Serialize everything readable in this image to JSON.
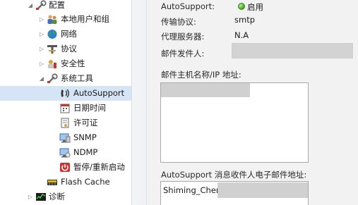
{
  "tree": {
    "items": [
      {
        "label": "配置",
        "icon": "wrench-icon",
        "expanded": true
      },
      {
        "label": "本地用户和组",
        "icon": "users-icon",
        "expanded": false
      },
      {
        "label": "网络",
        "icon": "globe-icon",
        "expanded": false
      },
      {
        "label": "协议",
        "icon": "protocol-icon",
        "expanded": false
      },
      {
        "label": "安全性",
        "icon": "security-icon",
        "expanded": false
      },
      {
        "label": "系统工具",
        "icon": "wrench-icon",
        "expanded": true
      },
      {
        "label": "AutoSupport",
        "icon": "autosupport-icon",
        "selected": true
      },
      {
        "label": "日期时间",
        "icon": "calendar-icon"
      },
      {
        "label": "许可证",
        "icon": "license-icon"
      },
      {
        "label": "SNMP",
        "icon": "snmp-icon"
      },
      {
        "label": "NDMP",
        "icon": "ndmp-icon"
      },
      {
        "label": "暂停/重新启动",
        "icon": "power-icon"
      },
      {
        "label": "Flash Cache",
        "icon": "flash-cache-icon"
      },
      {
        "label": "诊断",
        "icon": "diagnostics-icon",
        "expanded": false
      }
    ]
  },
  "form": {
    "autosupport_label": "AutoSupport:",
    "autosupport_value": "启用",
    "transport_label": "传输协议:",
    "transport_value": "smtp",
    "proxy_label": "代理服务器:",
    "proxy_value": "N.A",
    "sender_label": "邮件发件人:",
    "mailhost_label": "邮件主机名称/IP 地址:",
    "recipients_label": "AutoSupport 消息收件人电子邮件地址:",
    "recipient_value": "Shiming_Chen."
  },
  "colors": {
    "selected_row": "#d6e5f5",
    "status_green": "#4caf2a",
    "form_background": "#f2f2f2"
  }
}
